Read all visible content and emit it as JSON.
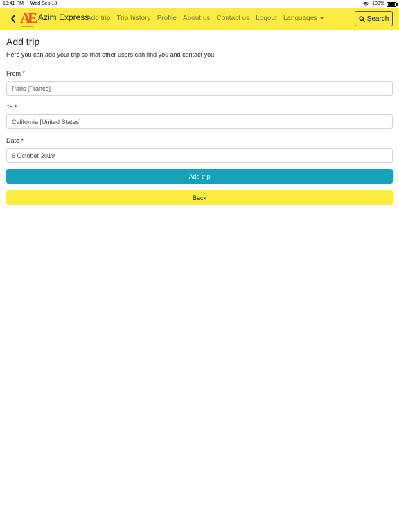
{
  "status_bar": {
    "time": "10:41 PM",
    "date": "Wed Sep 18",
    "battery": "100%"
  },
  "navbar": {
    "brand": "Azim Express",
    "logo_text": "AE",
    "logo_subtext": "Azim Express",
    "links": [
      "Add trip",
      "Trip history",
      "Profile",
      "About us",
      "Contact us",
      "Logout"
    ],
    "languages": "Languages",
    "search": "Search",
    "icons": [
      "chevron-left-icon",
      "search-icon",
      "wifi-icon",
      "battery-icon"
    ]
  },
  "page": {
    "title": "Add trip",
    "intro": "Here you can add your trip so that other users can find you and contact you!"
  },
  "form": {
    "from_label": "From *",
    "from_value": "Paris [France]",
    "to_label": "To *",
    "to_value": "California [United States]",
    "date_label": "Date *",
    "date_value": "6 October 2019",
    "submit": "Add trip",
    "back": "Back"
  },
  "colors": {
    "navbar": "#fdeb41",
    "primary_button": "#17a2b8",
    "back_button": "#fdeb41"
  }
}
